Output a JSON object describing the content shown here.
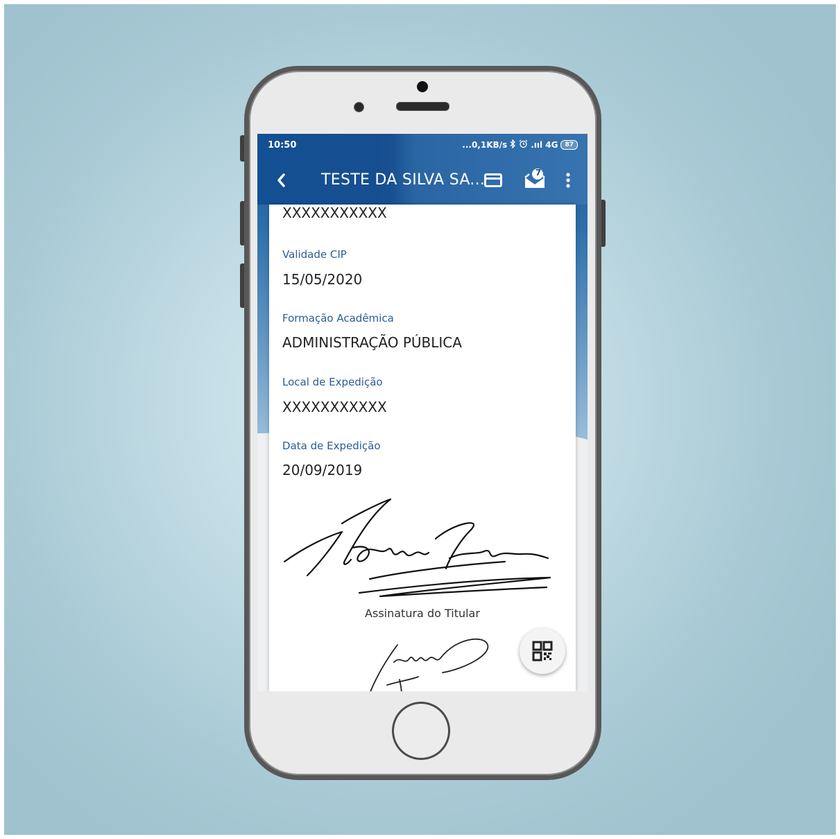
{
  "status_bar": {
    "time": "10:50",
    "indicators": "...0,1KB/s",
    "signal": ".ııl 4G",
    "battery": "87"
  },
  "app_bar": {
    "title": "TESTE DA SILVA SA...",
    "icons": [
      "back-arrow",
      "credit-card",
      "inbox-with-badge",
      "more-vertical"
    ],
    "inbox_badge": "7"
  },
  "card": {
    "top_value": "XXXXXXXXXXX",
    "fields": [
      {
        "label": "Validade CIP",
        "value": "15/05/2020"
      },
      {
        "label": "Formação Acadêmica",
        "value": "ADMINISTRAÇÃO PÚBLICA"
      },
      {
        "label": "Local de Expedição",
        "value": "XXXXXXXXXXX"
      },
      {
        "label": "Data de Expedição",
        "value": "20/09/2019"
      }
    ],
    "signature_caption": "Assinatura do Titular"
  },
  "fab": {
    "icon": "qr-code"
  },
  "colors": {
    "app_bar": "#174f91",
    "label": "#2a5d95",
    "background": "#b4d2dc"
  }
}
